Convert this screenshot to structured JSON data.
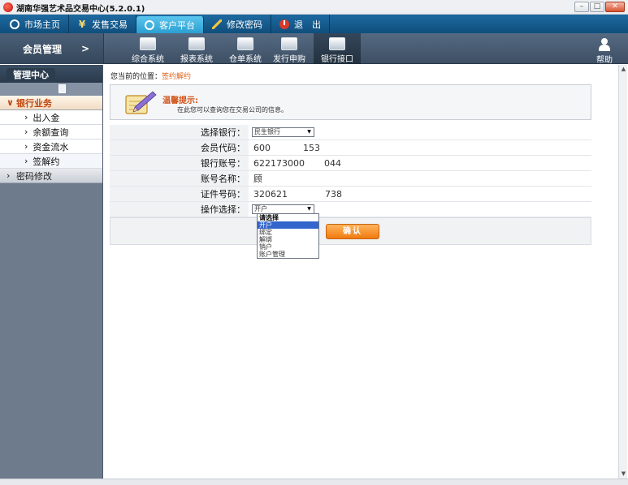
{
  "window": {
    "title": "湖南华强艺术品交易中心(5.2.0.1)",
    "buttons": {
      "minimize": "–",
      "maximize": "□",
      "close": "✕"
    }
  },
  "topnav": {
    "tabs": [
      {
        "label": "市场主页",
        "icon": "circle-arrow-icon"
      },
      {
        "label": "发售交易",
        "icon": "yen-icon"
      },
      {
        "label": "客户平台",
        "icon": "circle-arrow-icon",
        "active": true
      },
      {
        "label": "修改密码",
        "icon": "pencil-icon"
      },
      {
        "label": "退　出",
        "icon": "power-icon"
      }
    ]
  },
  "subnav": {
    "member_label": "会员管理",
    "member_arrow": ">",
    "systems": [
      {
        "label": "综合系统"
      },
      {
        "label": "报表系统"
      },
      {
        "label": "仓单系统"
      },
      {
        "label": "发行申购"
      },
      {
        "label": "银行接口",
        "active": true
      }
    ],
    "help_label": "帮助"
  },
  "sidebar": {
    "header": "管理中心",
    "groups": [
      {
        "label": "银行业务",
        "expanded": true,
        "items": [
          "出入金",
          "余额查询",
          "资金流水",
          "签解约"
        ]
      },
      {
        "label": "密码修改",
        "expanded": false
      }
    ]
  },
  "main": {
    "breadcrumb_prefix": "您当前的位置：",
    "breadcrumb_link": "签约解约",
    "tip_title": "温馨提示:",
    "tip_text": "在此您可以查询您在交易公司的信息。",
    "form": {
      "bank_label": "选择银行：",
      "bank_value": "民生银行",
      "member_code_label": "会员代码：",
      "member_code_part1": "600",
      "member_code_part2": "153",
      "account_label": "银行账号：",
      "account_part1": "622173000",
      "account_part2": "044",
      "account_name_label": "账号名称：",
      "account_name_value": "顾",
      "id_label": "证件号码：",
      "id_part1": "320621",
      "id_part2": "738",
      "operation_label": "操作选择：",
      "operation_value": "开户",
      "operation_options": [
        "请选择",
        "开户",
        "绑定",
        "解绑",
        "销户",
        "账户管理"
      ],
      "operation_highlighted_index": 1
    },
    "confirm_label": "确认"
  }
}
